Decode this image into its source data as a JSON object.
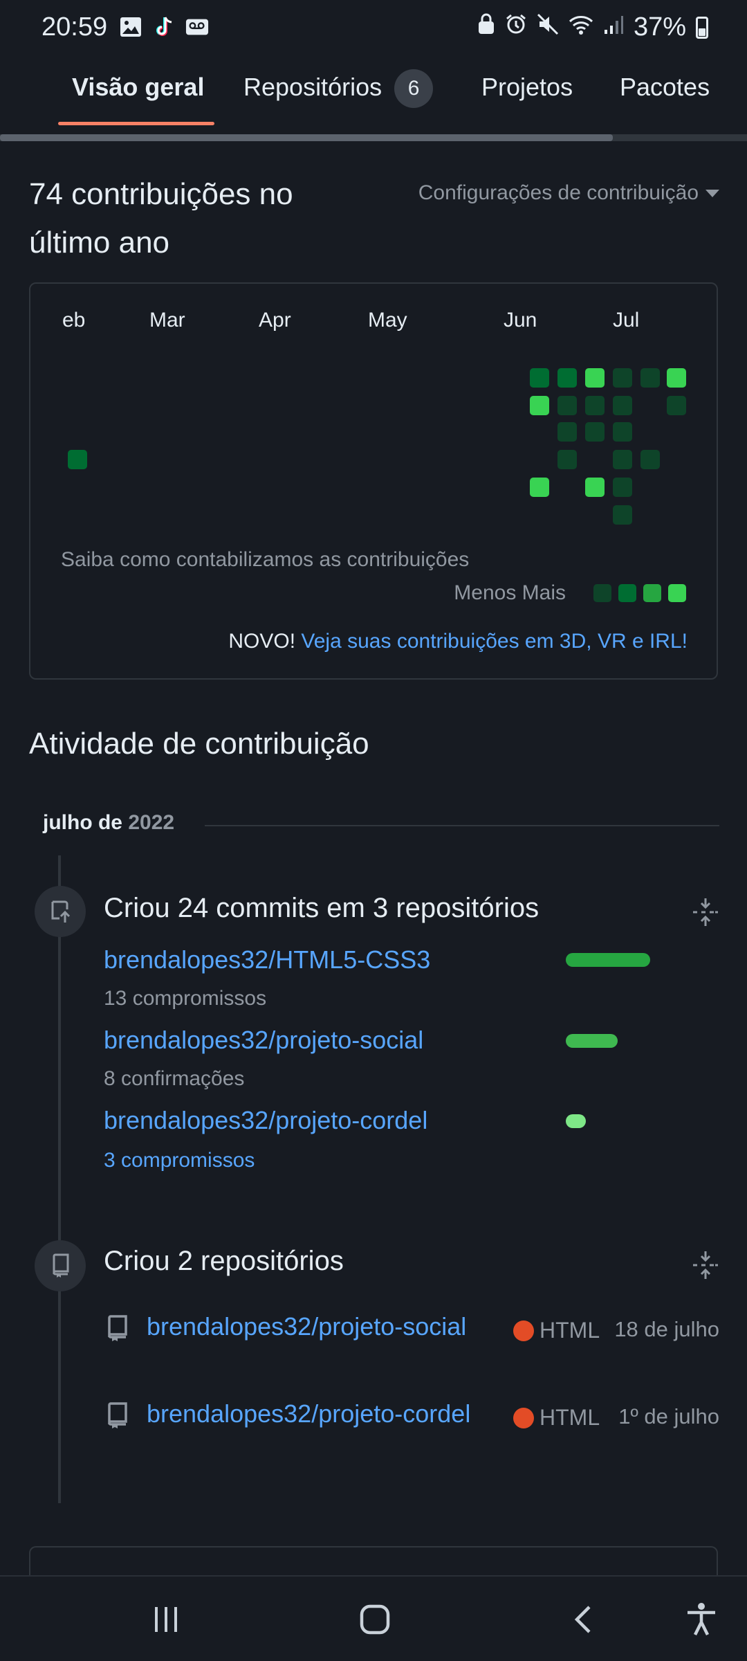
{
  "status_bar": {
    "time": "20:59",
    "battery": "37%",
    "left_icons": [
      "image-icon",
      "tiktok-icon",
      "voicemail-icon"
    ],
    "right_icons": [
      "lock-icon",
      "alarm-icon",
      "mute-icon",
      "wifi-icon",
      "signal-icon",
      "battery-icon"
    ]
  },
  "tabs": [
    {
      "label": "Visão geral",
      "active": true
    },
    {
      "label": "Repositórios",
      "badge": "6"
    },
    {
      "label": "Projetos"
    },
    {
      "label": "Pacotes"
    }
  ],
  "contributions": {
    "title": "74 contribuições no último ano",
    "settings_label": "Configurações de contribuição",
    "months": [
      "eb",
      "Mar",
      "Apr",
      "May",
      "Jun",
      "Jul"
    ],
    "help_text": "Saiba como contabilizamos as contribuições",
    "legend_text": "Menos Mais",
    "novo_prefix": "NOVO!",
    "novo_link": "Veja suas contribuições em 3D, VR e IRL!",
    "colors": {
      "lvl1": "#0e4429",
      "lvl2": "#006d32",
      "lvl3": "#26a641",
      "lvl4": "#39d353"
    }
  },
  "activity": {
    "title": "Atividade de contribuição",
    "month": "julho de",
    "year": "2022",
    "commits": {
      "title": "Criou 24 commits em 3 repositórios",
      "repos": [
        {
          "name": "brendalopes32/HTML5-CSS3",
          "count": "13 compromissos",
          "share": 0.54
        },
        {
          "name": "brendalopes32/projeto-social",
          "count": "8 confirmações",
          "share": 0.33
        },
        {
          "name": "brendalopes32/projeto-cordel",
          "count": "3 compromissos",
          "share": 0.13
        }
      ]
    },
    "created": {
      "title": "Criou 2 repositórios",
      "repos": [
        {
          "name": "brendalopes32/projeto-social",
          "language": "HTML",
          "date": "18 de julho"
        },
        {
          "name": "brendalopes32/projeto-cordel",
          "language": "HTML",
          "date": "1º de julho"
        }
      ]
    }
  },
  "nav": [
    "recents-button",
    "home-button",
    "back-button",
    "accessibility-button"
  ]
}
